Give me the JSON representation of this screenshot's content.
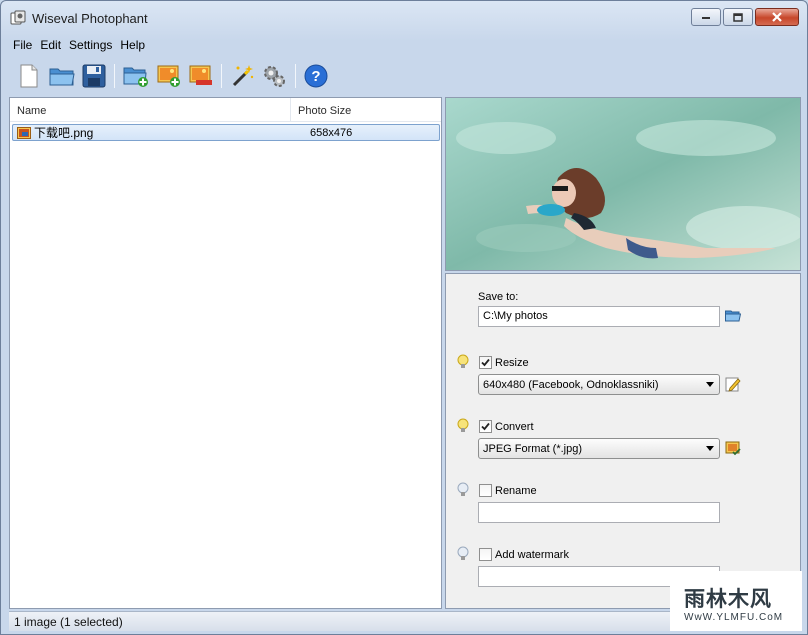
{
  "window": {
    "title": "Wiseval Photophant"
  },
  "menu": [
    "File",
    "Edit",
    "Settings",
    "Help"
  ],
  "toolbar": [
    {
      "name": "new-icon"
    },
    {
      "name": "open-folder-icon"
    },
    {
      "name": "save-icon"
    },
    {
      "name": "add-folder-icon"
    },
    {
      "name": "add-image-icon"
    },
    {
      "name": "remove-image-icon"
    },
    {
      "name": "magic-wand-icon"
    },
    {
      "name": "settings-gears-icon"
    },
    {
      "name": "help-icon"
    }
  ],
  "file_list": {
    "columns": [
      "Name",
      "Photo Size"
    ],
    "rows": [
      {
        "name": "下载吧.png",
        "size": "658x476",
        "selected": true
      }
    ]
  },
  "settings": {
    "save_to_label": "Save to:",
    "save_to_value": "C:\\My photos",
    "resize_label": "Resize",
    "resize_checked": true,
    "resize_value": "640x480 (Facebook, Odnoklassniki)",
    "convert_label": "Convert",
    "convert_checked": true,
    "convert_value": "JPEG Format (*.jpg)",
    "rename_label": "Rename",
    "rename_checked": false,
    "rename_value": "",
    "watermark_label": "Add watermark",
    "watermark_checked": false,
    "watermark_value": ""
  },
  "status": {
    "text": "1 image (1 selected)"
  },
  "watermark_logo": {
    "main": "雨林木风",
    "sub": "WwW.YLMFU.CoM"
  },
  "colors": {
    "selection": "#d3e4f8",
    "selection_border": "#7da2ce",
    "close_button": "#c7462a",
    "help_blue": "#2a6fd6"
  }
}
